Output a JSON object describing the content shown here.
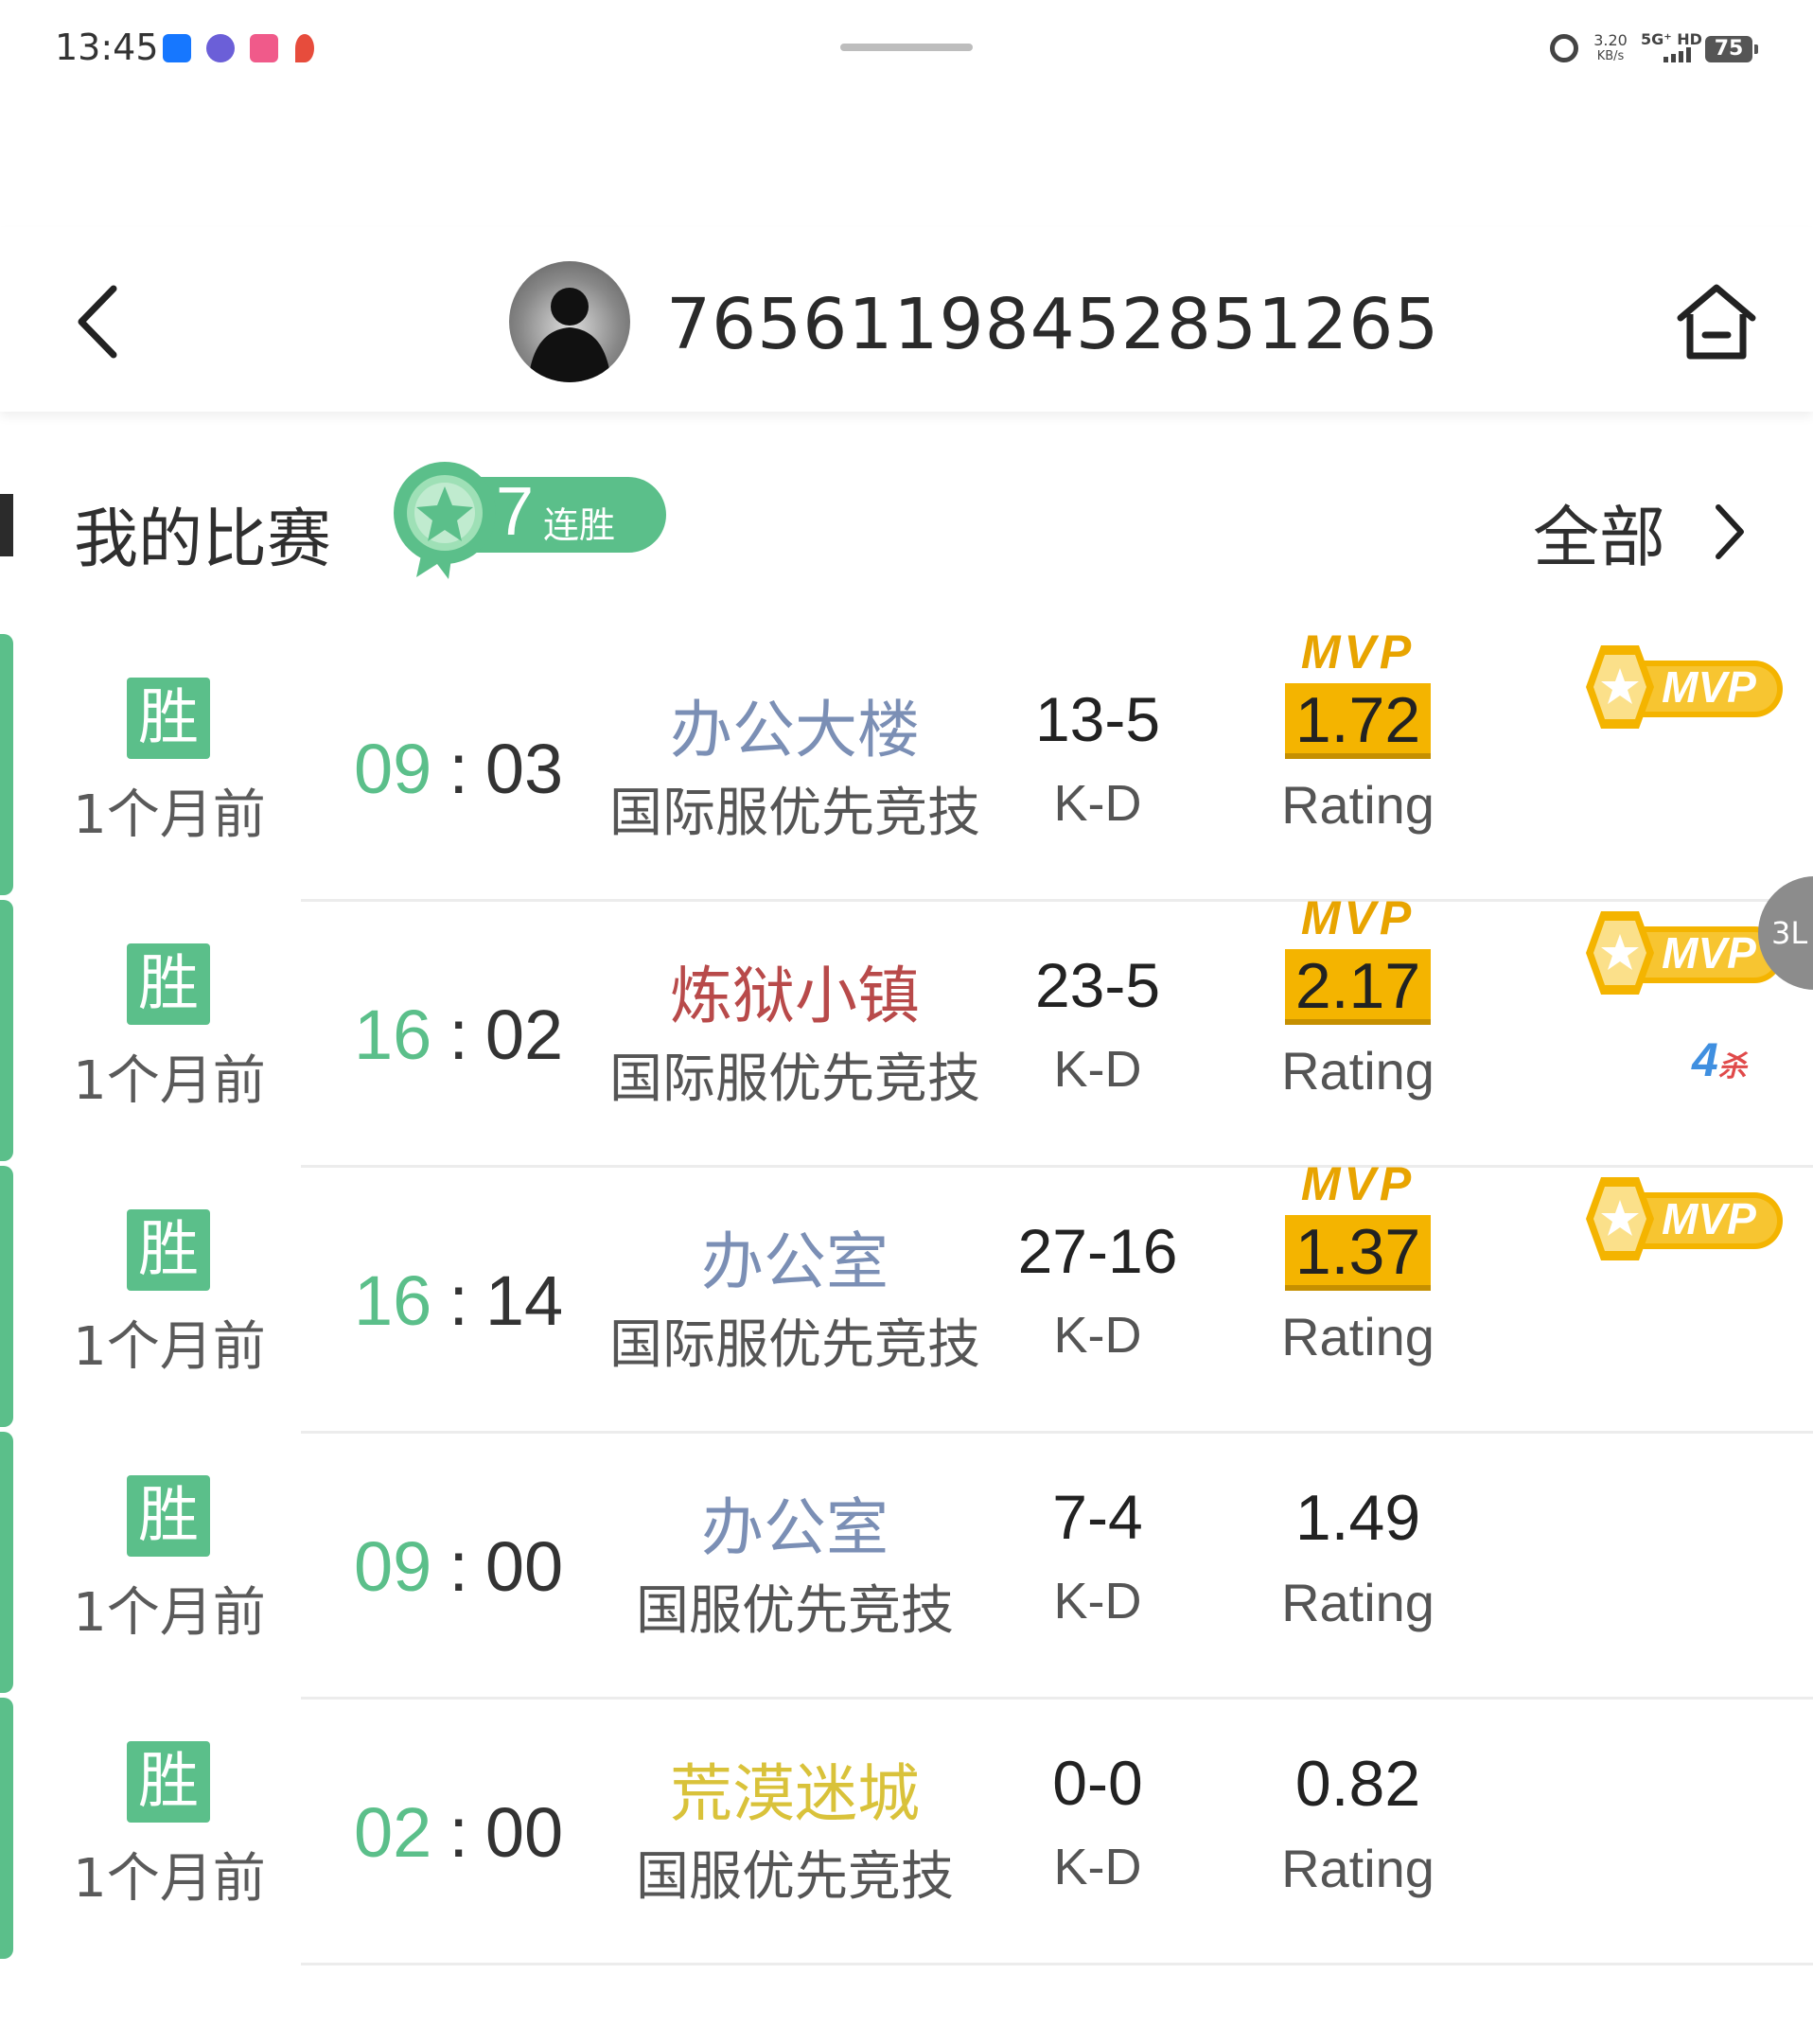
{
  "status_bar": {
    "time": "13:45",
    "net_speed_value": "3.20",
    "net_speed_unit": "KB/s",
    "network": "5G⁺ HD",
    "battery": "75"
  },
  "header": {
    "title": "76561198452851265"
  },
  "section": {
    "title": "我的比赛",
    "streak_count": "7",
    "streak_label": "连胜",
    "all_link": "全部"
  },
  "colors": {
    "accent_green": "#5bbf8a",
    "mvp_gold": "#f4b400",
    "map_blue": "#7b8fb5",
    "map_red": "#b84a4a",
    "map_yellow": "#d9c23a"
  },
  "matches": [
    {
      "result": "胜",
      "time_ago": "1个月前",
      "duration_min": "09",
      "duration_sec": "03",
      "map": "办公大楼",
      "map_color": "#7b8fb5",
      "mode": "国际服优先竞技",
      "kd": "13-5",
      "kd_label": "K-D",
      "mvp_tag": "MVP",
      "rating": "1.72",
      "rating_label": "Rating",
      "mvp_award": "MVP",
      "kills_badge": null
    },
    {
      "result": "胜",
      "time_ago": "1个月前",
      "duration_min": "16",
      "duration_sec": "02",
      "map": "炼狱小镇",
      "map_color": "#b84a4a",
      "mode": "国际服优先竞技",
      "kd": "23-5",
      "kd_label": "K-D",
      "mvp_tag": "MVP",
      "rating": "2.17",
      "rating_label": "Rating",
      "mvp_award": "MVP",
      "kills_badge": "4",
      "kills_badge_suffix": "杀"
    },
    {
      "result": "胜",
      "time_ago": "1个月前",
      "duration_min": "16",
      "duration_sec": "14",
      "map": "办公室",
      "map_color": "#7b8fb5",
      "mode": "国际服优先竞技",
      "kd": "27-16",
      "kd_label": "K-D",
      "mvp_tag": "MVP",
      "rating": "1.37",
      "rating_label": "Rating",
      "mvp_award": "MVP",
      "kills_badge": null
    },
    {
      "result": "胜",
      "time_ago": "1个月前",
      "duration_min": "09",
      "duration_sec": "00",
      "map": "办公室",
      "map_color": "#7b8fb5",
      "mode": "国服优先竞技",
      "kd": "7-4",
      "kd_label": "K-D",
      "mvp_tag": null,
      "rating": "1.49",
      "rating_label": "Rating",
      "mvp_award": null,
      "kills_badge": null
    },
    {
      "result": "胜",
      "time_ago": "1个月前",
      "duration_min": "02",
      "duration_sec": "00",
      "map": "荒漠迷城",
      "map_color": "#d9c23a",
      "mode": "国服优先竞技",
      "kd": "0-0",
      "kd_label": "K-D",
      "mvp_tag": null,
      "rating": "0.82",
      "rating_label": "Rating",
      "mvp_award": null,
      "kills_badge": null
    }
  ],
  "float_handle_label": "3L"
}
